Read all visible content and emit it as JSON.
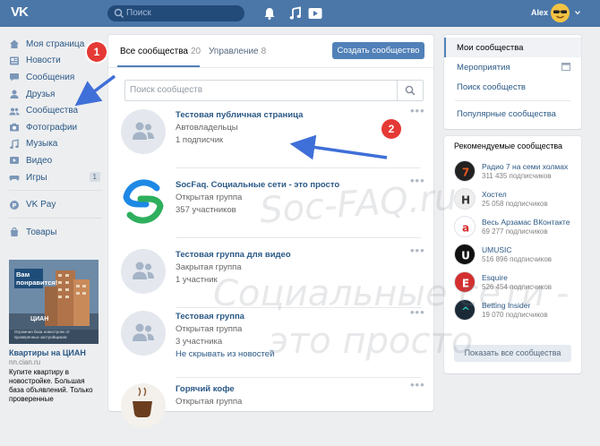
{
  "header": {
    "logo": "VK",
    "search_placeholder": "Поиск",
    "user_name": "Alex",
    "colors": {
      "bar": "#4a76a8"
    },
    "icons": [
      "bell-icon",
      "music-icon",
      "video-icon",
      "chevron-down-icon"
    ]
  },
  "leftnav": {
    "items": [
      {
        "label": "Моя страница",
        "icon": "home-icon"
      },
      {
        "label": "Новости",
        "icon": "news-icon"
      },
      {
        "label": "Сообщения",
        "icon": "message-icon"
      },
      {
        "label": "Друзья",
        "icon": "friend-icon"
      },
      {
        "label": "Сообщества",
        "icon": "communities-icon"
      },
      {
        "label": "Фотографии",
        "icon": "camera-icon"
      },
      {
        "label": "Музыка",
        "icon": "music-icon"
      },
      {
        "label": "Видео",
        "icon": "video-icon"
      },
      {
        "label": "Игры",
        "icon": "games-icon",
        "count": "1"
      }
    ],
    "pay": {
      "label": "VK Pay",
      "icon": "vkpay-icon"
    },
    "goods": {
      "label": "Товары",
      "icon": "goods-icon"
    }
  },
  "ad": {
    "image_text_1": "Вам понравится!",
    "image_brand": "ЦИАН",
    "image_text_2": "Огромная база новостроек от проверенных застройщиков",
    "title": "Квартиры на ЦИАН",
    "url": "nn.cian.ru",
    "text": "Купите квартиру в новостройке. Большая база объявлений. Только проверенные"
  },
  "main": {
    "tabs": [
      {
        "label": "Все сообщества",
        "count": "20",
        "active": true
      },
      {
        "label": "Управление",
        "count": "8",
        "active": false
      }
    ],
    "create_button": "Создать сообщество",
    "search_placeholder": "Поиск сообществ",
    "groups": [
      {
        "name": "Тестовая публичная страница",
        "type": "Автовладельцы",
        "count": "1 подписчик",
        "extra": "",
        "avatar": "placeholder"
      },
      {
        "name": "SocFaq. Социальные сети - это просто",
        "type": "Открытая группа",
        "count": "357 участников",
        "extra": "",
        "avatar": "socfaq-logo"
      },
      {
        "name": "Тестовая группа для видео",
        "type": "Закрытая группа",
        "count": "1 участник",
        "extra": "",
        "avatar": "placeholder"
      },
      {
        "name": "Тестовая группа",
        "type": "Открытая группа",
        "count": "3 участника",
        "extra": "Не скрывать из новостей",
        "avatar": "placeholder"
      },
      {
        "name": "Горячий кофе",
        "type": "Открытая группа",
        "count": "",
        "extra": "",
        "avatar": "coffee"
      }
    ]
  },
  "right": {
    "menu": [
      {
        "label": "Мои сообщества",
        "active": true
      },
      {
        "label": "Мероприятия",
        "active": false,
        "icon": "calendar-icon"
      },
      {
        "label": "Поиск сообществ",
        "active": false
      },
      {
        "label": "Популярные сообщества",
        "active": false
      }
    ],
    "recommended_title": "Рекомендуемые сообщества",
    "recommended": [
      {
        "name": "Радио 7 на семи холмах",
        "count": "311 435 подписчиков",
        "color": "#222222",
        "accent": "#e25822",
        "icon": "radio7-logo",
        "glyph": "7"
      },
      {
        "name": "Хостел",
        "count": "25 058 подписчиков",
        "color": "#eeeeee",
        "accent": "#333333",
        "icon": "hostel-logo",
        "glyph": "H"
      },
      {
        "name": "Весь Арзамас ВКонтакте",
        "count": "69 277 подписчиков",
        "color": "#ffffff",
        "accent": "#d32f2f",
        "icon": "arzamas-logo",
        "glyph": "a"
      },
      {
        "name": "UMUSIC",
        "count": "516 896 подписчиков",
        "color": "#111111",
        "accent": "#ffffff",
        "icon": "umusic-logo",
        "glyph": "U"
      },
      {
        "name": "Esquire",
        "count": "526 454 подписчиков",
        "color": "#d32f2f",
        "accent": "#ffffff",
        "icon": "esquire-logo",
        "glyph": "E"
      },
      {
        "name": "Betting Insider",
        "count": "19 070 подписчиков",
        "color": "#1c2a38",
        "accent": "#27c2b0",
        "icon": "betting-logo",
        "glyph": "^"
      }
    ],
    "show_all_button": "Показать все сообщества"
  },
  "annotations": {
    "badge1": "1",
    "badge2": "2",
    "color": "#e53935",
    "arrow_color": "#3f6fd8"
  },
  "watermark": {
    "line1": "Soc-FAQ.ru",
    "line2": "Социальные сети -",
    "line3": "это просто"
  }
}
